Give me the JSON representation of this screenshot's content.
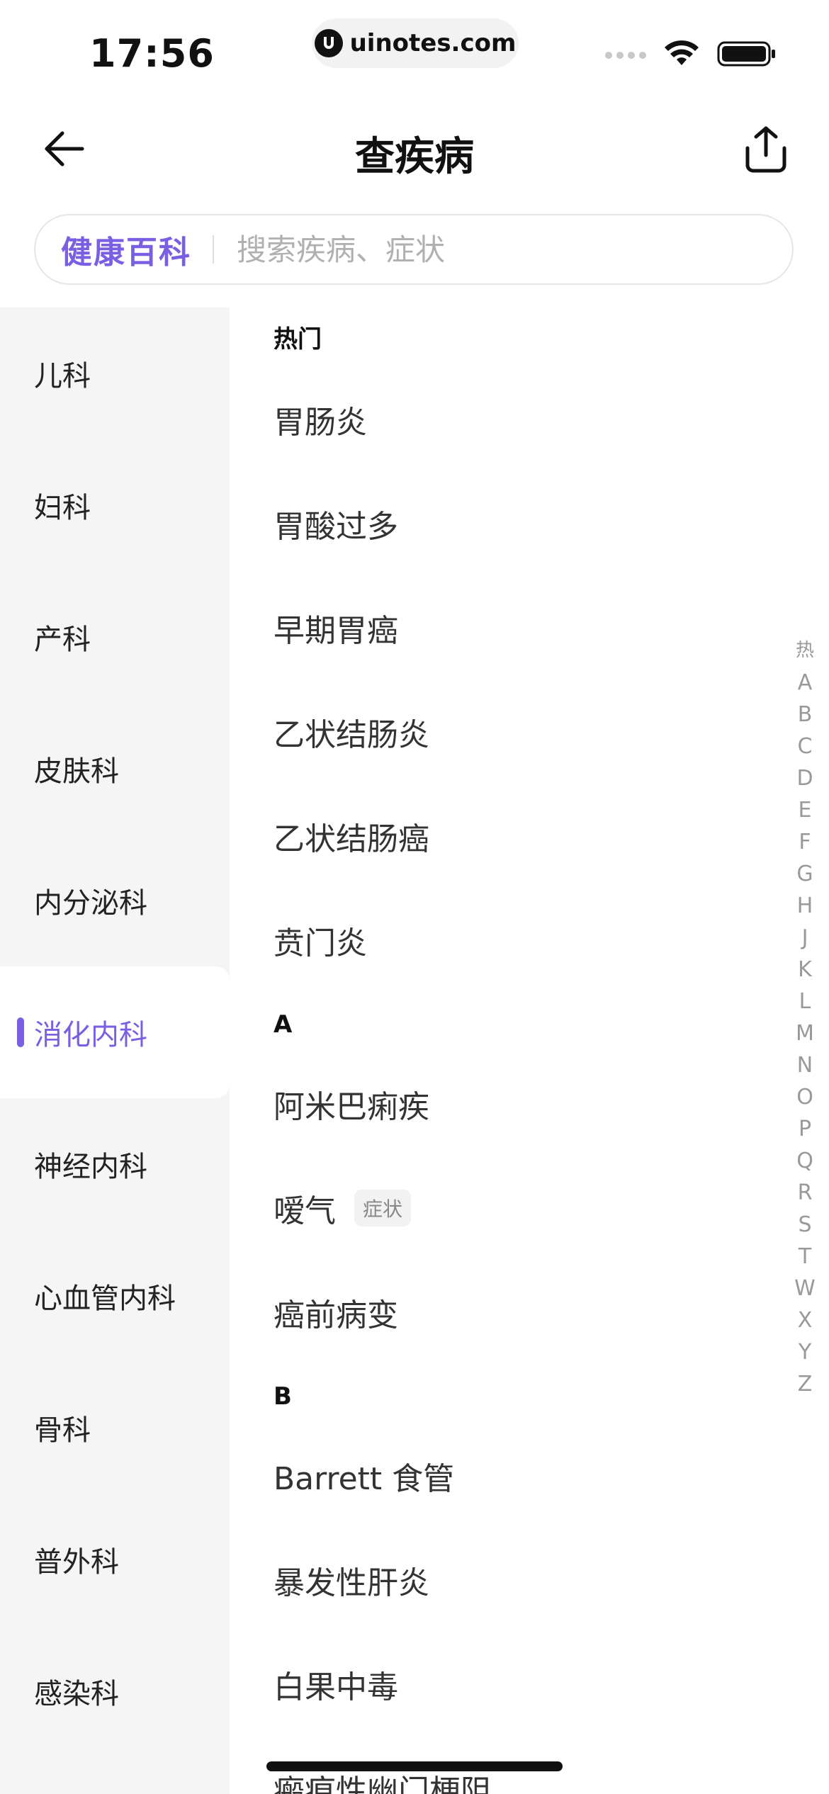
{
  "status_bar": {
    "time": "17:56",
    "url": "uinotes.com"
  },
  "nav": {
    "title": "查疾病"
  },
  "search": {
    "brand": "健康百科",
    "placeholder": "搜索疾病、症状"
  },
  "sidebar": {
    "items": [
      {
        "label": "儿科"
      },
      {
        "label": "妇科"
      },
      {
        "label": "产科"
      },
      {
        "label": "皮肤科"
      },
      {
        "label": "内分泌科"
      },
      {
        "label": "消化内科",
        "active": true
      },
      {
        "label": "神经内科"
      },
      {
        "label": "心血管内科"
      },
      {
        "label": "骨科"
      },
      {
        "label": "普外科"
      },
      {
        "label": "感染科"
      }
    ]
  },
  "content": {
    "sections": [
      {
        "header": "热门",
        "items": [
          {
            "label": "胃肠炎"
          },
          {
            "label": "胃酸过多"
          },
          {
            "label": "早期胃癌"
          },
          {
            "label": "乙状结肠炎"
          },
          {
            "label": "乙状结肠癌"
          },
          {
            "label": "贲门炎"
          }
        ]
      },
      {
        "header": "A",
        "items": [
          {
            "label": "阿米巴痢疾"
          },
          {
            "label": "嗳气",
            "tag": "症状"
          },
          {
            "label": "癌前病变"
          }
        ]
      },
      {
        "header": "B",
        "items": [
          {
            "label": "Barrett 食管"
          },
          {
            "label": "暴发性肝炎"
          },
          {
            "label": "白果中毒"
          },
          {
            "label": "瘢痕性幽门梗阻"
          }
        ]
      }
    ]
  },
  "index_bar": {
    "letters": [
      "热",
      "A",
      "B",
      "C",
      "D",
      "E",
      "F",
      "G",
      "H",
      "J",
      "K",
      "L",
      "M",
      "N",
      "O",
      "P",
      "Q",
      "R",
      "S",
      "T",
      "W",
      "X",
      "Y",
      "Z"
    ]
  },
  "colors": {
    "accent": "#7a5fe3",
    "sidebar_bg": "#f5f5f5"
  }
}
